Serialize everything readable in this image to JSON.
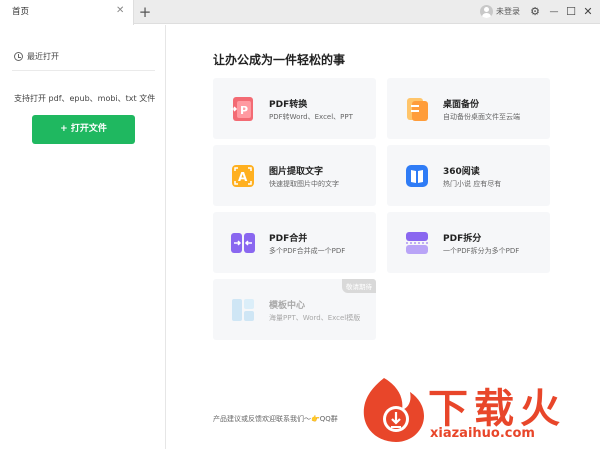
{
  "tabbar": {
    "tab_label": "首页",
    "close_glyph": "✕",
    "add_glyph": "+"
  },
  "window": {
    "user_label": "未登录",
    "settings_glyph": "⚙",
    "minimize_glyph": "—",
    "maximize_glyph": "☐",
    "close_glyph": "✕"
  },
  "sidebar": {
    "recent_label": "最近打开",
    "support_text": "支持打开 pdf、epub、mobi、txt 文件",
    "open_button": "+ 打开文件"
  },
  "main": {
    "title": "让办公成为一件轻松的事",
    "cards": [
      {
        "title": "PDF转换",
        "desc": "PDF转Word、Excel、PPT",
        "icon": "pdf-convert-icon"
      },
      {
        "title": "桌面备份",
        "desc": "自动备份桌面文件至云端",
        "icon": "desktop-backup-icon"
      },
      {
        "title": "图片提取文字",
        "desc": "快速提取图片中的文字",
        "icon": "ocr-icon"
      },
      {
        "title": "360阅读",
        "desc": "热门小说 应有尽有",
        "icon": "book-icon"
      },
      {
        "title": "PDF合并",
        "desc": "多个PDF合并成一个PDF",
        "icon": "pdf-merge-icon"
      },
      {
        "title": "PDF拆分",
        "desc": "一个PDF拆分为多个PDF",
        "icon": "pdf-split-icon"
      },
      {
        "title": "模板中心",
        "desc": "海量PPT、Word、Excel模版",
        "icon": "template-icon",
        "badge": "敬请期待"
      }
    ],
    "footer": "产品建议或反馈欢迎联系我们～👉QQ群"
  },
  "watermark": {
    "text": "下载火",
    "url": "xiazaihuo.com"
  },
  "colors": {
    "accent_green": "#1fb860",
    "watermark_red": "#e8462a",
    "card_bg": "#f6f7f9"
  }
}
